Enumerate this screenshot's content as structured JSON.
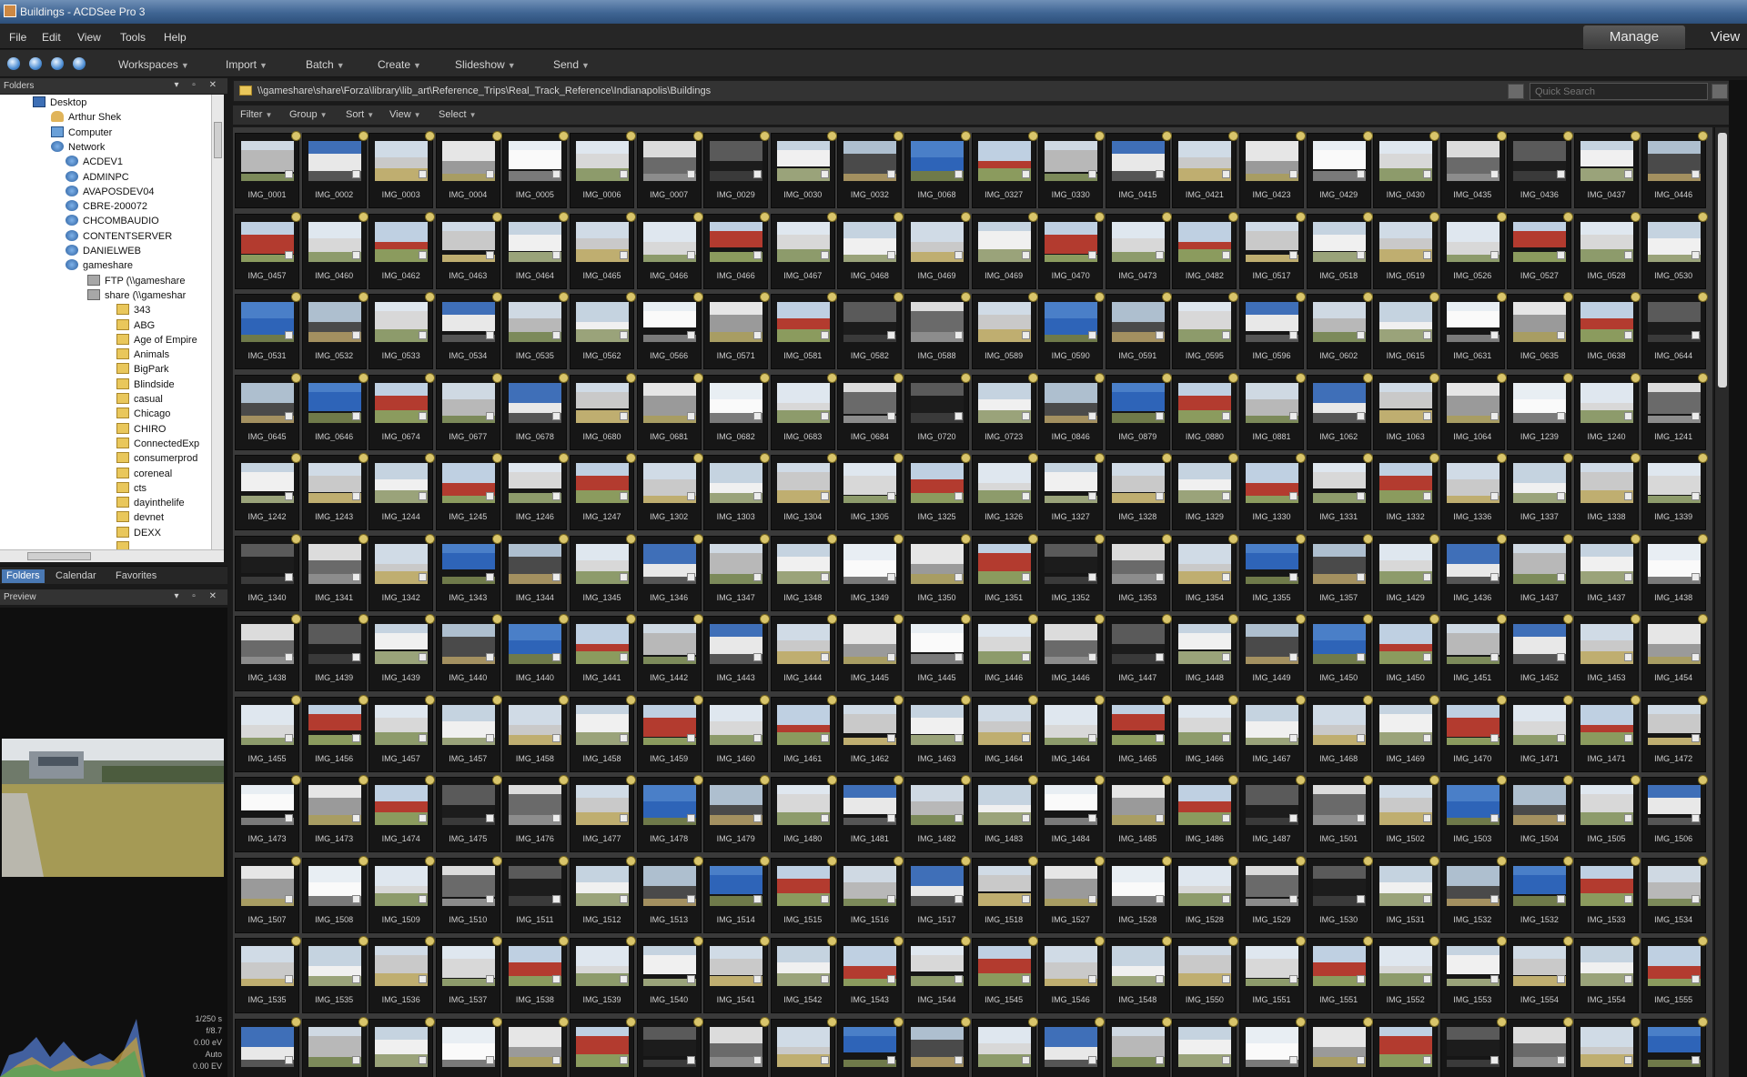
{
  "window": {
    "title": "Buildings - ACDSee Pro 3"
  },
  "menu": {
    "items": [
      "File",
      "Edit",
      "View",
      "Tools",
      "Help"
    ],
    "modes": [
      "Manage",
      "View"
    ]
  },
  "toolbar": {
    "items": [
      "Workspaces",
      "Import",
      "Batch",
      "Create",
      "Slideshow",
      "Send"
    ]
  },
  "folders_panel": {
    "title": "Folders",
    "nodes": [
      {
        "label": "Desktop",
        "icon": "desktop-icon",
        "depth": 0
      },
      {
        "label": "Arthur Shek",
        "icon": "user-folder-icon",
        "depth": 1
      },
      {
        "label": "Computer",
        "icon": "computer-icon",
        "depth": 1
      },
      {
        "label": "Network",
        "icon": "network-icon",
        "depth": 1
      },
      {
        "label": "ACDEV1",
        "icon": "network-icon",
        "depth": 2
      },
      {
        "label": "ADMINPC",
        "icon": "network-icon",
        "depth": 2
      },
      {
        "label": "AVAPOSDEV04",
        "icon": "network-icon",
        "depth": 2
      },
      {
        "label": "CBRE-200072",
        "icon": "network-icon",
        "depth": 2
      },
      {
        "label": "CHCOMBAUDIO",
        "icon": "network-icon",
        "depth": 2
      },
      {
        "label": "CONTENTSERVER",
        "icon": "network-icon",
        "depth": 2
      },
      {
        "label": "DANIELWEB",
        "icon": "network-icon",
        "depth": 2
      },
      {
        "label": "gameshare",
        "icon": "network-icon",
        "depth": 2
      },
      {
        "label": "FTP (\\\\gameshare",
        "icon": "ftp-icon",
        "depth": 3
      },
      {
        "label": "share (\\\\gameshar",
        "icon": "ftp-icon",
        "depth": 3
      },
      {
        "label": "343",
        "icon": "folder-icon",
        "depth": 4
      },
      {
        "label": "ABG",
        "icon": "folder-icon",
        "depth": 4
      },
      {
        "label": "Age of Empire",
        "icon": "folder-icon",
        "depth": 4
      },
      {
        "label": "Animals",
        "icon": "folder-icon",
        "depth": 4
      },
      {
        "label": "BigPark",
        "icon": "folder-icon",
        "depth": 4
      },
      {
        "label": "Blindside",
        "icon": "folder-icon",
        "depth": 4
      },
      {
        "label": "casual",
        "icon": "folder-icon",
        "depth": 4
      },
      {
        "label": "Chicago",
        "icon": "folder-icon",
        "depth": 4
      },
      {
        "label": "CHIRO",
        "icon": "folder-icon",
        "depth": 4
      },
      {
        "label": "ConnectedExp",
        "icon": "folder-icon",
        "depth": 4
      },
      {
        "label": "consumerprod",
        "icon": "folder-icon",
        "depth": 4
      },
      {
        "label": "coreneal",
        "icon": "folder-icon",
        "depth": 4
      },
      {
        "label": "cts",
        "icon": "folder-icon",
        "depth": 4
      },
      {
        "label": "dayinthelife",
        "icon": "folder-icon",
        "depth": 4
      },
      {
        "label": "devnet",
        "icon": "folder-icon",
        "depth": 4
      },
      {
        "label": "DEXX",
        "icon": "folder-icon",
        "depth": 4
      },
      {
        "label": "",
        "icon": "folder-icon",
        "depth": 4
      }
    ]
  },
  "left_tabs": [
    "Folders",
    "Calendar",
    "Favorites"
  ],
  "preview_panel": {
    "title": "Preview"
  },
  "exif": [
    "1/250 s",
    "f/8.7",
    "0.00 eV",
    "Auto",
    "0.00 EV"
  ],
  "path": {
    "text": "\\\\gameshare\\share\\Forza\\library\\lib_art\\Reference_Trips\\Real_Track_Reference\\Indianapolis\\Buildings"
  },
  "search": {
    "placeholder": "Quick Search"
  },
  "filterbar": {
    "items": [
      "Filter",
      "Group",
      "Sort",
      "View",
      "Select"
    ]
  },
  "thumbnails": {
    "columns": 22,
    "rows": [
      [
        "IMG_0001",
        "IMG_0002",
        "IMG_0003",
        "IMG_0004",
        "IMG_0005",
        "IMG_0006",
        "IMG_0007",
        "IMG_0029",
        "IMG_0030",
        "IMG_0032",
        "IMG_0068",
        "IMG_0327",
        "IMG_0330",
        "IMG_0415",
        "IMG_0421",
        "IMG_0423",
        "IMG_0429",
        "IMG_0430",
        "IMG_0435",
        "IMG_0436",
        "IMG_0437",
        "IMG_0446"
      ],
      [
        "IMG_0457",
        "IMG_0460",
        "IMG_0462",
        "IMG_0463",
        "IMG_0464",
        "IMG_0465",
        "IMG_0466",
        "IMG_0466",
        "IMG_0467",
        "IMG_0468",
        "IMG_0469",
        "IMG_0469",
        "IMG_0470",
        "IMG_0473",
        "IMG_0482",
        "IMG_0517",
        "IMG_0518",
        "IMG_0519",
        "IMG_0526",
        "IMG_0527",
        "IMG_0528",
        "IMG_0530"
      ],
      [
        "IMG_0531",
        "IMG_0532",
        "IMG_0533",
        "IMG_0534",
        "IMG_0535",
        "IMG_0562",
        "IMG_0566",
        "IMG_0571",
        "IMG_0581",
        "IMG_0582",
        "IMG_0588",
        "IMG_0589",
        "IMG_0590",
        "IMG_0591",
        "IMG_0595",
        "IMG_0596",
        "IMG_0602",
        "IMG_0615",
        "IMG_0631",
        "IMG_0635",
        "IMG_0638",
        "IMG_0644"
      ],
      [
        "IMG_0645",
        "IMG_0646",
        "IMG_0674",
        "IMG_0677",
        "IMG_0678",
        "IMG_0680",
        "IMG_0681",
        "IMG_0682",
        "IMG_0683",
        "IMG_0684",
        "IMG_0720",
        "IMG_0723",
        "IMG_0846",
        "IMG_0879",
        "IMG_0880",
        "IMG_0881",
        "IMG_1062",
        "IMG_1063",
        "IMG_1064",
        "IMG_1239",
        "IMG_1240",
        "IMG_1241"
      ],
      [
        "IMG_1242",
        "IMG_1243",
        "IMG_1244",
        "IMG_1245",
        "IMG_1246",
        "IMG_1247",
        "IMG_1302",
        "IMG_1303",
        "IMG_1304",
        "IMG_1305",
        "IMG_1325",
        "IMG_1326",
        "IMG_1327",
        "IMG_1328",
        "IMG_1329",
        "IMG_1330",
        "IMG_1331",
        "IMG_1332",
        "IMG_1336",
        "IMG_1337",
        "IMG_1338",
        "IMG_1339"
      ],
      [
        "IMG_1340",
        "IMG_1341",
        "IMG_1342",
        "IMG_1343",
        "IMG_1344",
        "IMG_1345",
        "IMG_1346",
        "IMG_1347",
        "IMG_1348",
        "IMG_1349",
        "IMG_1350",
        "IMG_1351",
        "IMG_1352",
        "IMG_1353",
        "IMG_1354",
        "IMG_1355",
        "IMG_1357",
        "IMG_1429",
        "IMG_1436",
        "IMG_1437",
        "IMG_1437",
        "IMG_1438"
      ],
      [
        "IMG_1438",
        "IMG_1439",
        "IMG_1439",
        "IMG_1440",
        "IMG_1440",
        "IMG_1441",
        "IMG_1442",
        "IMG_1443",
        "IMG_1444",
        "IMG_1445",
        "IMG_1445",
        "IMG_1446",
        "IMG_1446",
        "IMG_1447",
        "IMG_1448",
        "IMG_1449",
        "IMG_1450",
        "IMG_1450",
        "IMG_1451",
        "IMG_1452",
        "IMG_1453",
        "IMG_1454"
      ],
      [
        "IMG_1455",
        "IMG_1456",
        "IMG_1457",
        "IMG_1457",
        "IMG_1458",
        "IMG_1458",
        "IMG_1459",
        "IMG_1460",
        "IMG_1461",
        "IMG_1462",
        "IMG_1463",
        "IMG_1464",
        "IMG_1464",
        "IMG_1465",
        "IMG_1466",
        "IMG_1467",
        "IMG_1468",
        "IMG_1469",
        "IMG_1470",
        "IMG_1471",
        "IMG_1471",
        "IMG_1472"
      ],
      [
        "IMG_1473",
        "IMG_1473",
        "IMG_1474",
        "IMG_1475",
        "IMG_1476",
        "IMG_1477",
        "IMG_1478",
        "IMG_1479",
        "IMG_1480",
        "IMG_1481",
        "IMG_1482",
        "IMG_1483",
        "IMG_1484",
        "IMG_1485",
        "IMG_1486",
        "IMG_1487",
        "IMG_1501",
        "IMG_1502",
        "IMG_1503",
        "IMG_1504",
        "IMG_1505",
        "IMG_1506"
      ],
      [
        "IMG_1507",
        "IMG_1508",
        "IMG_1509",
        "IMG_1510",
        "IMG_1511",
        "IMG_1512",
        "IMG_1513",
        "IMG_1514",
        "IMG_1515",
        "IMG_1516",
        "IMG_1517",
        "IMG_1518",
        "IMG_1527",
        "IMG_1528",
        "IMG_1528",
        "IMG_1529",
        "IMG_1530",
        "IMG_1531",
        "IMG_1532",
        "IMG_1532",
        "IMG_1533",
        "IMG_1534"
      ],
      [
        "IMG_1535",
        "IMG_1535",
        "IMG_1536",
        "IMG_1537",
        "IMG_1538",
        "IMG_1539",
        "IMG_1540",
        "IMG_1541",
        "IMG_1542",
        "IMG_1543",
        "IMG_1544",
        "IMG_1545",
        "IMG_1546",
        "IMG_1548",
        "IMG_1550",
        "IMG_1551",
        "IMG_1551",
        "IMG_1552",
        "IMG_1553",
        "IMG_1554",
        "IMG_1554",
        "IMG_1555"
      ],
      [
        "",
        "",
        "",
        "",
        "",
        "",
        "",
        "",
        "",
        "",
        "",
        "",
        "",
        "",
        "",
        "",
        "",
        "",
        "",
        "",
        "",
        ""
      ]
    ]
  },
  "colors": {
    "accent": "#4a79b4",
    "grid_bg": "#3a3a3a",
    "cell_bg": "#161616",
    "badge": "#d9c56b"
  }
}
